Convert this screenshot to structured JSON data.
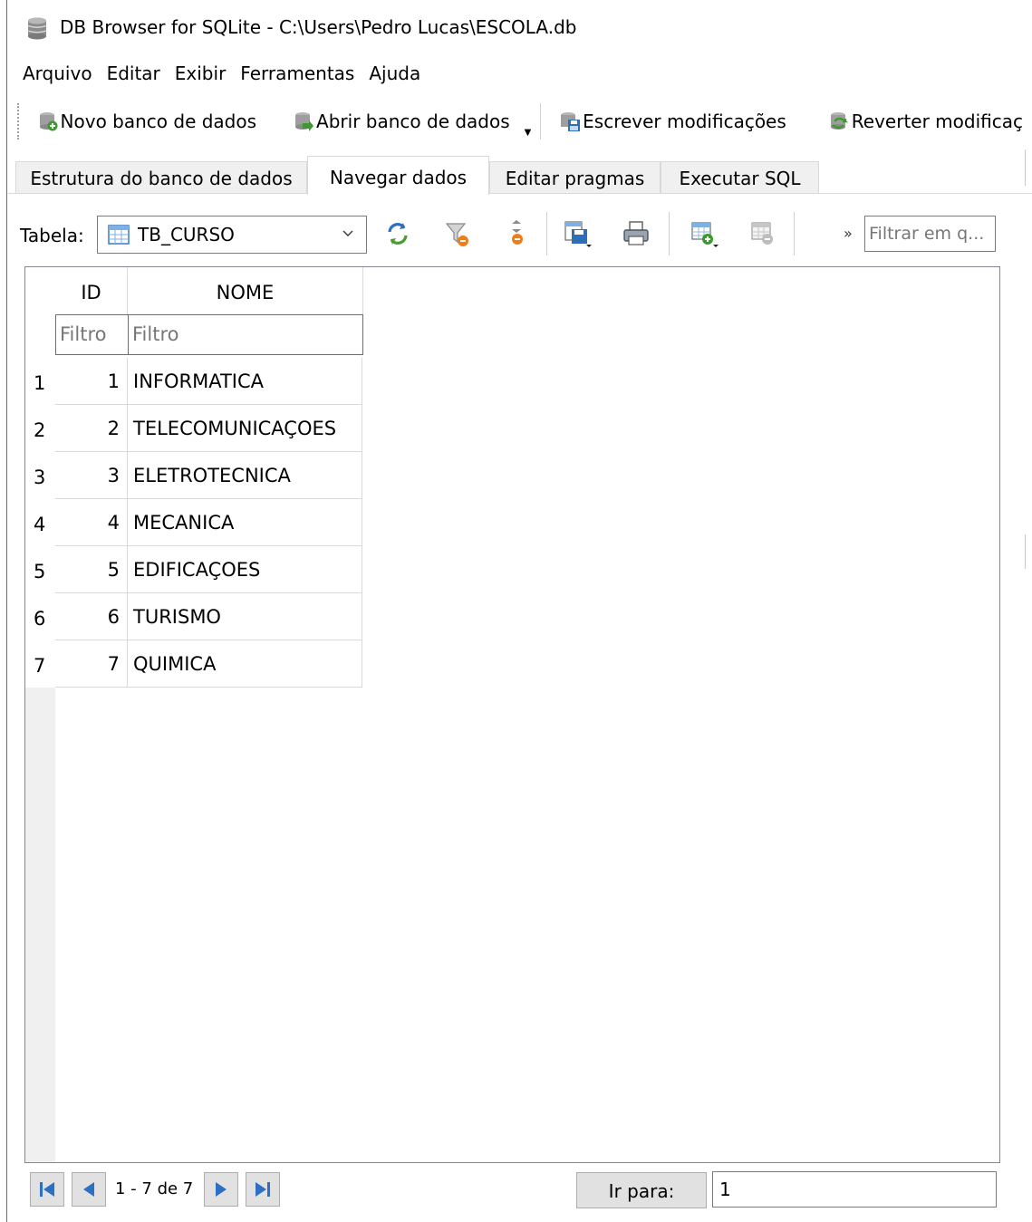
{
  "window": {
    "title": "DB Browser for SQLite - C:\\Users\\Pedro Lucas\\ESCOLA.db",
    "icon": "database-icon"
  },
  "menu": [
    "Arquivo",
    "Editar",
    "Exibir",
    "Ferramentas",
    "Ajuda"
  ],
  "toolbar": {
    "new_db": "Novo banco de dados",
    "open_db": "Abrir banco de dados",
    "write_changes": "Escrever modificações",
    "revert_changes": "Reverter modificaç"
  },
  "tabs": [
    "Estrutura do banco de dados",
    "Navegar dados",
    "Editar pragmas",
    "Executar SQL"
  ],
  "active_tab": "Navegar dados",
  "browse": {
    "table_label": "Tabela:",
    "table_value": "TB_CURSO",
    "more_label": "»",
    "filter_placeholder": "Filtrar em q..."
  },
  "grid": {
    "columns": [
      "ID",
      "NOME"
    ],
    "filter_placeholder": "Filtro",
    "rows": [
      {
        "rownum": "1",
        "id": "1",
        "nome": "INFORMATICA"
      },
      {
        "rownum": "2",
        "id": "2",
        "nome": "TELECOMUNICAÇOES"
      },
      {
        "rownum": "3",
        "id": "3",
        "nome": "ELETROTECNICA"
      },
      {
        "rownum": "4",
        "id": "4",
        "nome": "MECANICA"
      },
      {
        "rownum": "5",
        "id": "5",
        "nome": "EDIFICAÇOES"
      },
      {
        "rownum": "6",
        "id": "6",
        "nome": "TURISMO"
      },
      {
        "rownum": "7",
        "id": "7",
        "nome": "QUIMICA"
      }
    ]
  },
  "pager": {
    "range_text": "1 - 7 de 7",
    "goto_label": "Ir para:",
    "goto_value": "1"
  }
}
